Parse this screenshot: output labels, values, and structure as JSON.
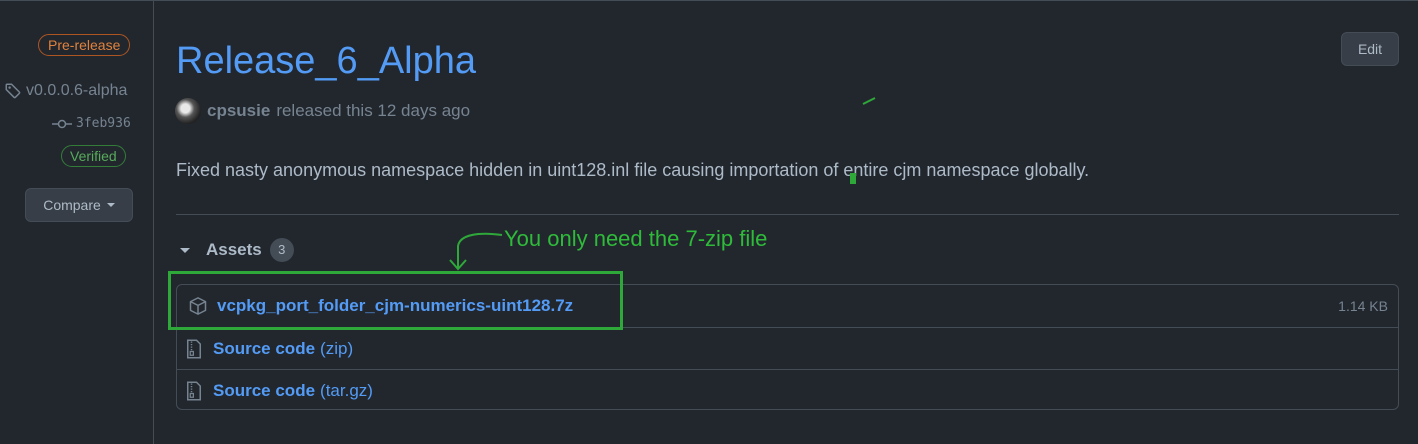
{
  "sidebar": {
    "prerelease_badge": "Pre-release",
    "tag": "v0.0.0.6-alpha",
    "commit": "3feb936",
    "verified_badge": "Verified",
    "compare_label": "Compare"
  },
  "release": {
    "title": "Release_6_Alpha",
    "edit_label": "Edit",
    "author": "cpsusie",
    "released_text": "released this 12 days ago",
    "description": "Fixed nasty anonymous namespace hidden in uint128.inl file causing importation of entire cjm namespace globally."
  },
  "assets": {
    "header": "Assets",
    "count": "3",
    "items": [
      {
        "name": "vcpkg_port_folder_cjm-numerics-uint128.7z",
        "format": "",
        "size": "1.14 KB",
        "icon": "package-icon"
      },
      {
        "name": "Source code",
        "format": "(zip)",
        "size": "",
        "icon": "file-zip-icon"
      },
      {
        "name": "Source code",
        "format": "(tar.gz)",
        "size": "",
        "icon": "file-zip-icon"
      }
    ]
  },
  "annotation": {
    "text": "You only need the 7-zip file",
    "color": "#2fa83a"
  }
}
